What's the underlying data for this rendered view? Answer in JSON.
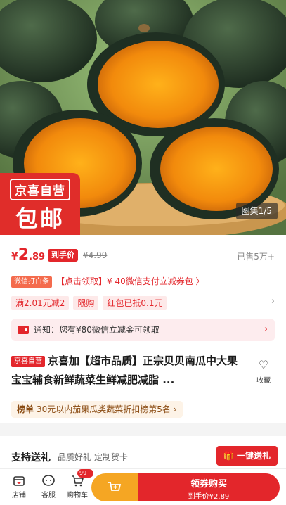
{
  "hero": {
    "brand_badge_line1": "京喜自营",
    "brand_badge_line2": "包邮",
    "gallery_count": "图集1/5"
  },
  "price": {
    "currency": "¥",
    "integer": "2",
    "decimal": ".89",
    "arrival_tag": "到手价",
    "original": "¥4.99",
    "sold": "已售5万+"
  },
  "coupon": {
    "source": "微信打白条",
    "text": "【点击领取】¥ 40微信支付立减券包 〉"
  },
  "promotions": {
    "items": [
      "满2.01元减2",
      "限购",
      "红包已抵0.1元"
    ],
    "arrow": "›"
  },
  "notice": {
    "text": "通知：您有¥80微信立减金可领取",
    "arrow": "›"
  },
  "product": {
    "tag": "京喜自营",
    "title": "京喜加【超市品质】正宗贝贝南瓜中大果宝宝辅食新鲜蔬菜生鲜减肥减脂 ...",
    "favorite_label": "收藏"
  },
  "rank": {
    "label": "榜单",
    "text": "30元以内茄果瓜类蔬菜折扣榜第5名 ›"
  },
  "gift": {
    "heading": "支持送礼",
    "subtitle": "品质好礼 定制贺卡",
    "button": "一键送礼"
  },
  "bottom_bar": {
    "store": "店铺",
    "service": "客服",
    "cart": "购物车",
    "cart_badge": "99+",
    "buy_line1": "领券购买",
    "buy_line2": "到手价¥2.89"
  },
  "colors": {
    "accent_red": "#e3262b",
    "cart_button": "#f5a623",
    "rank_text": "#8a4b12"
  }
}
